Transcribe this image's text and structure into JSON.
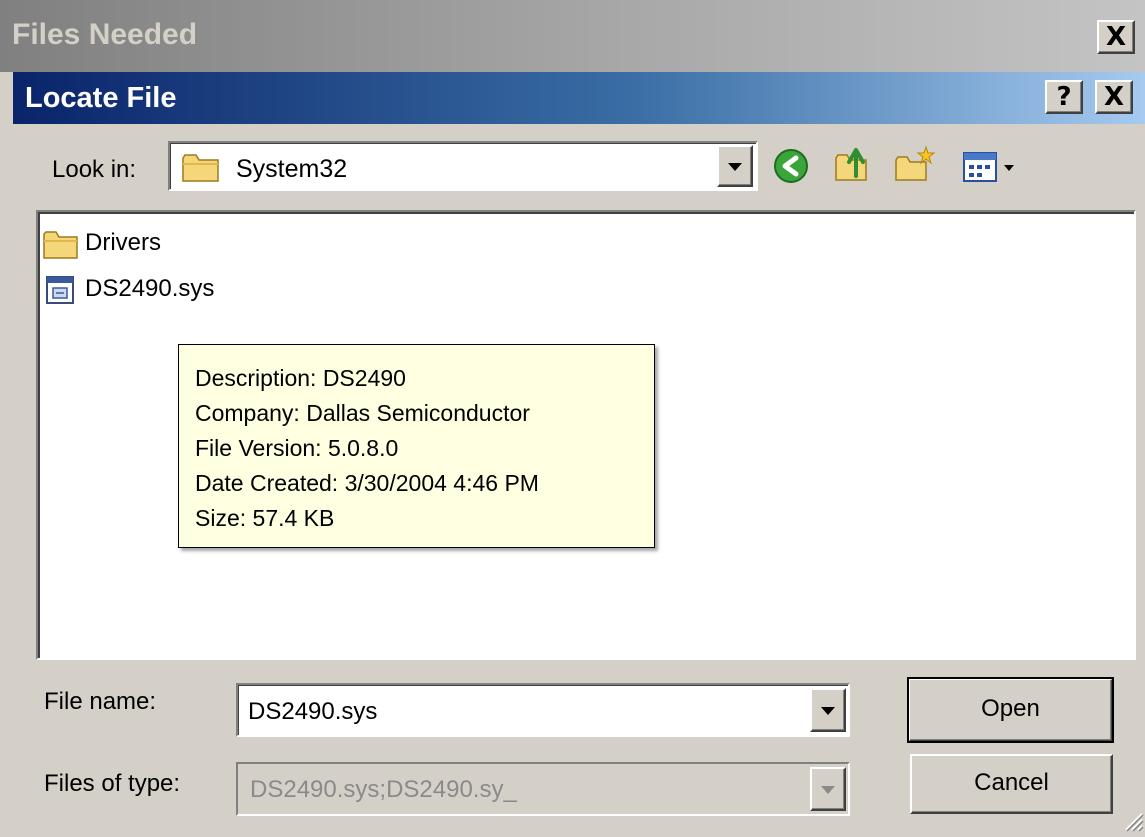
{
  "outer_window": {
    "title": "Files Needed",
    "close_label": "X"
  },
  "dialog": {
    "title": "Locate File",
    "help_label": "?",
    "close_label": "X"
  },
  "look_in": {
    "label": "Look in:",
    "value": "System32",
    "icon": "folder-icon",
    "toolbar_icons": [
      "back-icon",
      "up-folder-icon",
      "new-folder-icon",
      "views-menu-icon"
    ]
  },
  "file_list": {
    "items": [
      {
        "name": "Drivers",
        "icon": "folder-icon"
      },
      {
        "name": "DS2490.sys",
        "icon": "system-file-icon"
      }
    ]
  },
  "tooltip": {
    "description": "Description: DS2490",
    "company": "Company: Dallas Semiconductor",
    "file_version": "File Version: 5.0.8.0",
    "date_created": "Date Created: 3/30/2004 4:46 PM",
    "size": "Size: 57.4 KB"
  },
  "file_name": {
    "label": "File name:",
    "value": "DS2490.sys"
  },
  "file_type": {
    "label": "Files of type:",
    "value": "DS2490.sys;DS2490.sy_"
  },
  "buttons": {
    "open": "Open",
    "cancel": "Cancel"
  },
  "colors": {
    "active_title_start": "#0a246a",
    "active_title_end": "#a6caf0",
    "dialog_face": "#d4d0c8",
    "tooltip_background": "#ffffe1"
  }
}
